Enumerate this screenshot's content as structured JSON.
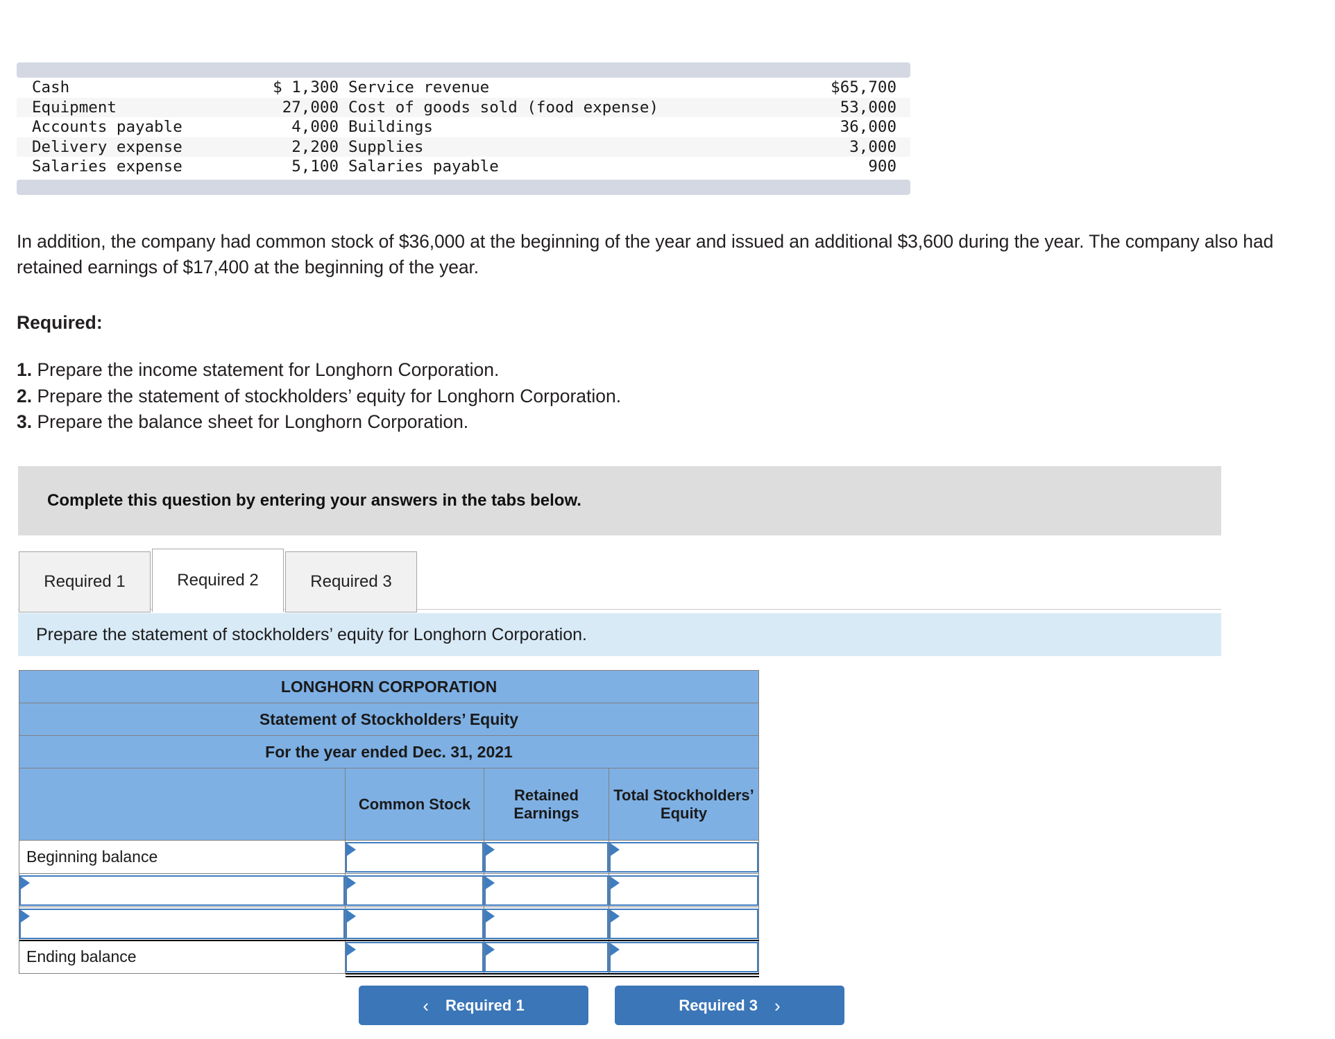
{
  "trial_balance": {
    "rows": [
      {
        "name_left": "Cash",
        "value_left": "$ 1,300",
        "name_right": "Service revenue",
        "value_right": "$65,700"
      },
      {
        "name_left": "Equipment",
        "value_left": "27,000",
        "name_right": "Cost of goods sold (food expense)",
        "value_right": "53,000"
      },
      {
        "name_left": "Accounts payable",
        "value_left": "4,000",
        "name_right": "Buildings",
        "value_right": "36,000"
      },
      {
        "name_left": "Delivery expense",
        "value_left": "2,200",
        "name_right": "Supplies",
        "value_right": "3,000"
      },
      {
        "name_left": "Salaries expense",
        "value_left": "5,100",
        "name_right": "Salaries payable",
        "value_right": "900"
      }
    ]
  },
  "intro": {
    "paragraph": "In addition, the company had common stock of $36,000 at the beginning of the year and issued an additional $3,600 during the year. The company also had retained earnings of $17,400 at the beginning of the year."
  },
  "required": {
    "heading": "Required:",
    "items": [
      {
        "num": "1.",
        "text": "Prepare the income statement for Longhorn Corporation."
      },
      {
        "num": "2.",
        "text": "Prepare the statement of stockholders’ equity for Longhorn Corporation."
      },
      {
        "num": "3.",
        "text": "Prepare the balance sheet for Longhorn Corporation."
      }
    ]
  },
  "instruction_panel": {
    "text": "Complete this question by entering your answers in the tabs below."
  },
  "tabs": {
    "items": [
      {
        "label": "Required 1",
        "active": false
      },
      {
        "label": "Required 2",
        "active": true
      },
      {
        "label": "Required 3",
        "active": false
      }
    ]
  },
  "tab_instruction": {
    "text": "Prepare the statement of stockholders’ equity for Longhorn Corporation."
  },
  "worksheet": {
    "title_line1": "LONGHORN CORPORATION",
    "title_line2": "Statement of Stockholders’ Equity",
    "title_line3": "For the year ended Dec. 31, 2021",
    "columns": [
      {
        "label": ""
      },
      {
        "label": "Common Stock"
      },
      {
        "label": "Retained Earnings"
      },
      {
        "label": "Total Stockholders’ Equity"
      }
    ],
    "rows": [
      {
        "label": "Beginning balance",
        "label_is_input": false,
        "common_stock": "",
        "retained_earnings": "",
        "total_equity": "",
        "rule": "none"
      },
      {
        "label": "",
        "label_is_input": true,
        "common_stock": "",
        "retained_earnings": "",
        "total_equity": "",
        "rule": "none"
      },
      {
        "label": "",
        "label_is_input": true,
        "common_stock": "",
        "retained_earnings": "",
        "total_equity": "",
        "rule": "single"
      },
      {
        "label": "Ending balance",
        "label_is_input": false,
        "common_stock": "",
        "retained_earnings": "",
        "total_equity": "",
        "rule": "double"
      }
    ]
  },
  "nav": {
    "prev_label": "Required 1",
    "next_label": "Required 3",
    "prev_icon": "chevron-left-icon",
    "next_icon": "chevron-right-icon",
    "prev_chevron": "‹",
    "next_chevron": "›"
  },
  "colors": {
    "sheet_header_blue": "#7eb0e4",
    "input_border_blue": "#3f7dc0",
    "button_blue": "#3b76b8",
    "instruction_blue": "#d9eaf7",
    "panel_gray": "#dddddd",
    "cap_gray": "#d3d8e3"
  }
}
